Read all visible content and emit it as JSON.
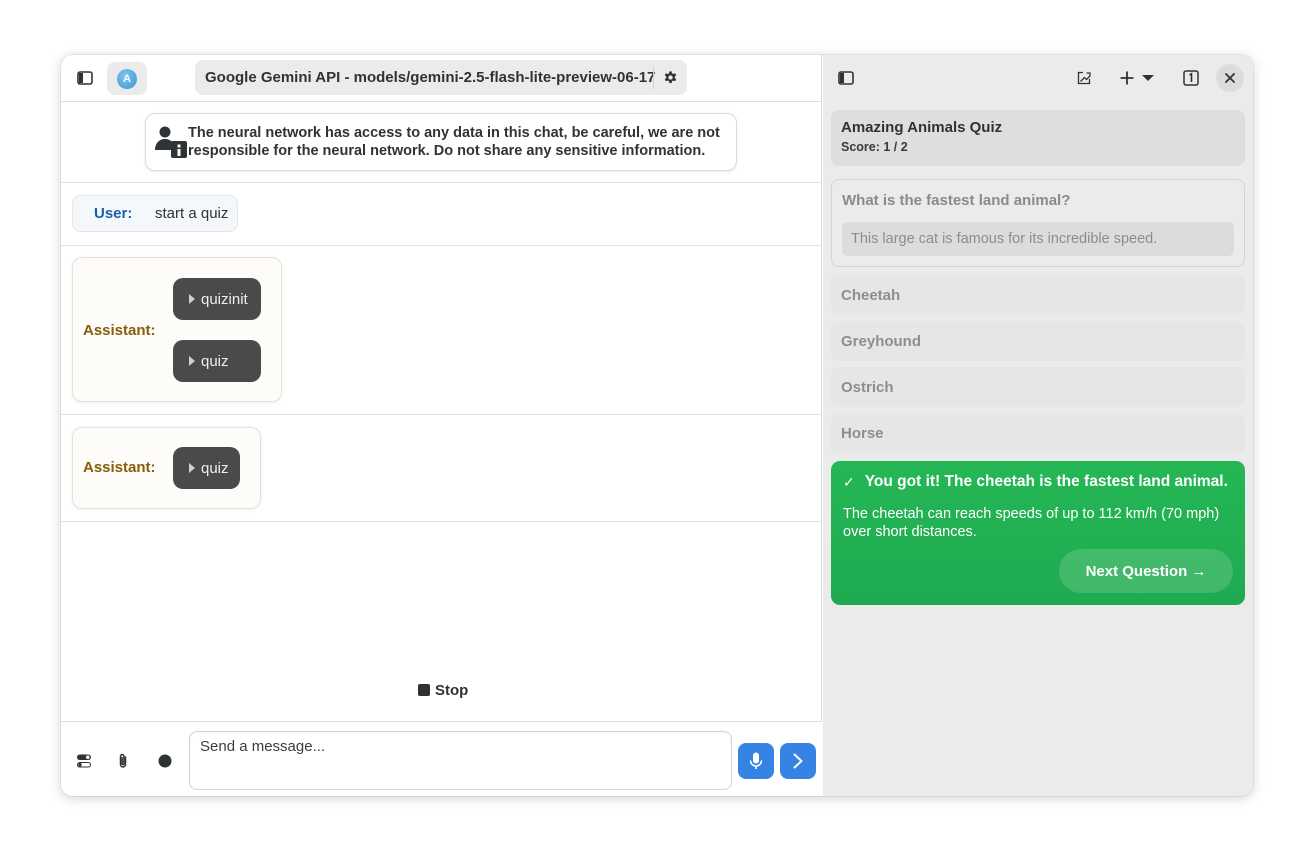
{
  "header": {
    "model_name": "Google Gemini API - models/gemini-2.5-flash-lite-preview-06-17",
    "avatar_letter": "A"
  },
  "disclaimer": {
    "text": "The neural network has access to any data in this chat, be careful, we are not responsible for the neural network. Do not share any sensitive information."
  },
  "messages": {
    "user_role": "User:",
    "user_text": "start a quiz",
    "assistant_role": "Assistant:",
    "assistant_1_tools": [
      "quizinit",
      "quiz"
    ],
    "assistant_2_tools": [
      "quiz"
    ]
  },
  "stop_label": "Stop",
  "composer": {
    "placeholder": "Send a message..."
  },
  "quiz": {
    "title": "Amazing Animals Quiz",
    "score": "Score: 1 / 2",
    "question": "What is the fastest land animal?",
    "hint": "This large cat is famous for its incredible speed.",
    "options": [
      "Cheetah",
      "Greyhound",
      "Ostrich",
      "Horse"
    ],
    "result_check": "✓",
    "result_title": "You got it! The cheetah is the fastest land animal.",
    "result_body": "The cheetah can reach speeds of up to 112 km/h (70 mph) over short distances.",
    "next_label": "Next Question →"
  },
  "colors": {
    "accent_blue": "#3584e4",
    "success_green": "#22b052",
    "user_role": "#1a5fb4",
    "assistant_role": "#865e09"
  }
}
